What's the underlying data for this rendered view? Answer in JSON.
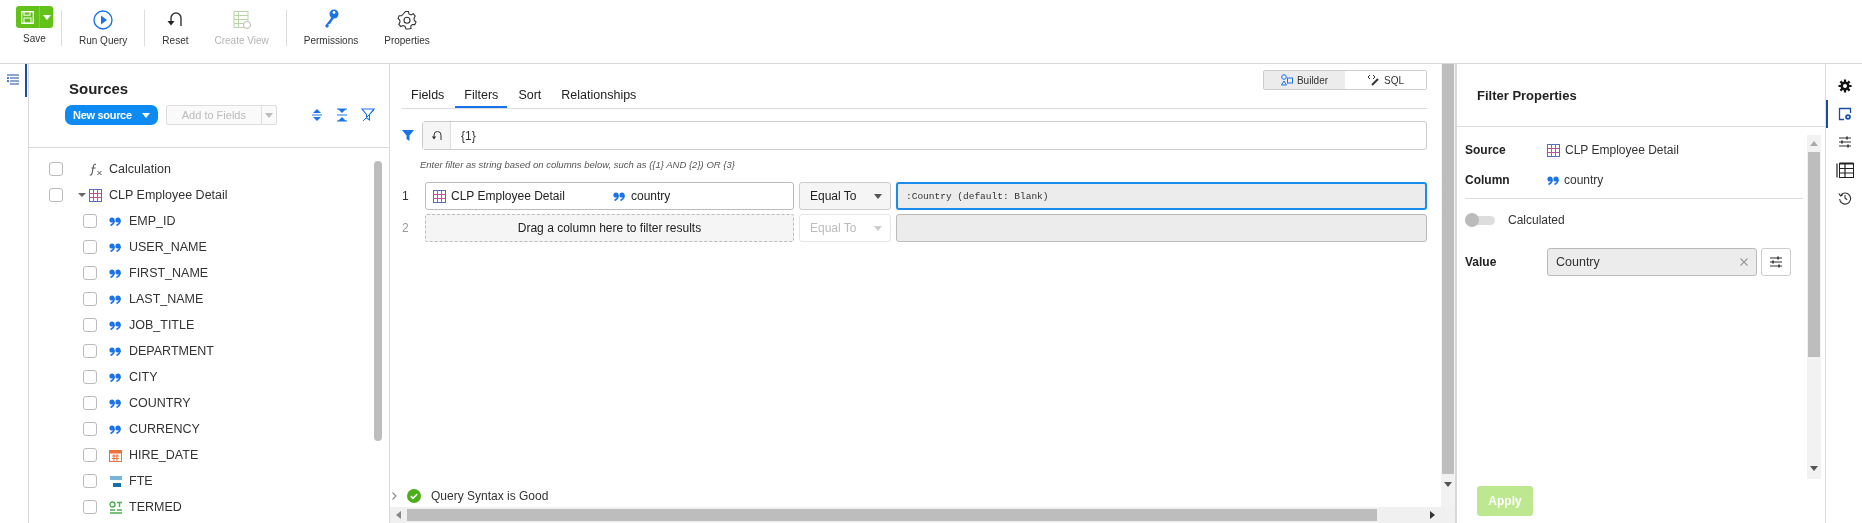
{
  "toolbar": [
    {
      "label": "Save",
      "kind": "save",
      "disabled": false,
      "separator_after": true
    },
    {
      "label": "Run Query",
      "kind": "run",
      "disabled": false,
      "separator_after": true
    },
    {
      "label": "Reset",
      "kind": "reset",
      "disabled": false,
      "separator_after": false
    },
    {
      "label": "Create View",
      "kind": "view",
      "disabled": true,
      "separator_after": true
    },
    {
      "label": "Permissions",
      "kind": "permissions",
      "disabled": false,
      "separator_after": false
    },
    {
      "label": "Properties",
      "kind": "properties",
      "disabled": false,
      "separator_after": false
    }
  ],
  "sources": {
    "title": "Sources",
    "new_source": "New source",
    "add_to_fields": "Add to Fields",
    "items": [
      {
        "label": "Calculation",
        "kind": "calculation",
        "checked": false
      },
      {
        "label": "CLP Employee Detail",
        "kind": "table",
        "checked": false,
        "expanded": true,
        "children": [
          {
            "label": "EMP_ID",
            "kind": "text",
            "checked": false
          },
          {
            "label": "USER_NAME",
            "kind": "text",
            "checked": false
          },
          {
            "label": "FIRST_NAME",
            "kind": "text",
            "checked": false
          },
          {
            "label": "LAST_NAME",
            "kind": "text",
            "checked": false
          },
          {
            "label": "JOB_TITLE",
            "kind": "text",
            "checked": false
          },
          {
            "label": "DEPARTMENT",
            "kind": "text",
            "checked": false
          },
          {
            "label": "CITY",
            "kind": "text",
            "checked": false
          },
          {
            "label": "COUNTRY",
            "kind": "text",
            "checked": false
          },
          {
            "label": "CURRENCY",
            "kind": "text",
            "checked": false
          },
          {
            "label": "HIRE_DATE",
            "kind": "date",
            "checked": false
          },
          {
            "label": "FTE",
            "kind": "number",
            "checked": false
          },
          {
            "label": "TERMED",
            "kind": "boolean",
            "checked": false
          }
        ]
      }
    ]
  },
  "tabs": [
    {
      "label": "Fields",
      "selected": false
    },
    {
      "label": "Filters",
      "selected": true
    },
    {
      "label": "Sort",
      "selected": false
    },
    {
      "label": "Relationships",
      "selected": false
    }
  ],
  "modes": [
    {
      "label": "Builder",
      "kind": "builder",
      "selected": true
    },
    {
      "label": "SQL",
      "kind": "sql",
      "selected": false
    }
  ],
  "filter_expression": {
    "value": "{1}",
    "hint": "Enter filter as string based on columns below, such as ({1} AND {2}) OR {3}"
  },
  "conditions": [
    {
      "number": "1",
      "kind": "condition",
      "source": "CLP Employee Detail",
      "column": "country",
      "operator": "Equal To",
      "operator_disabled": false,
      "value": ":Country (default: Blank)",
      "focused": true
    },
    {
      "number": "2",
      "kind": "drop_target",
      "text": "Drag a column here to filter results",
      "operator": "Equal To",
      "operator_disabled": true,
      "focused": false
    }
  ],
  "status": {
    "text": "Query Syntax is Good",
    "valid": true
  },
  "properties": {
    "title": "Filter Properties",
    "source_label": "Source",
    "source": "CLP Employee Detail",
    "column_label": "Column",
    "column": "country",
    "calculated_label": "Calculated",
    "calculated": false,
    "value_label": "Value",
    "value": "Country",
    "apply": "Apply",
    "apply_disabled": true
  },
  "right_rail": [
    {
      "kind": "settings",
      "selected": false
    },
    {
      "kind": "properties",
      "selected": true
    },
    {
      "kind": "sliders",
      "selected": false
    },
    {
      "kind": "table",
      "selected": false
    },
    {
      "kind": "history",
      "selected": false
    }
  ]
}
